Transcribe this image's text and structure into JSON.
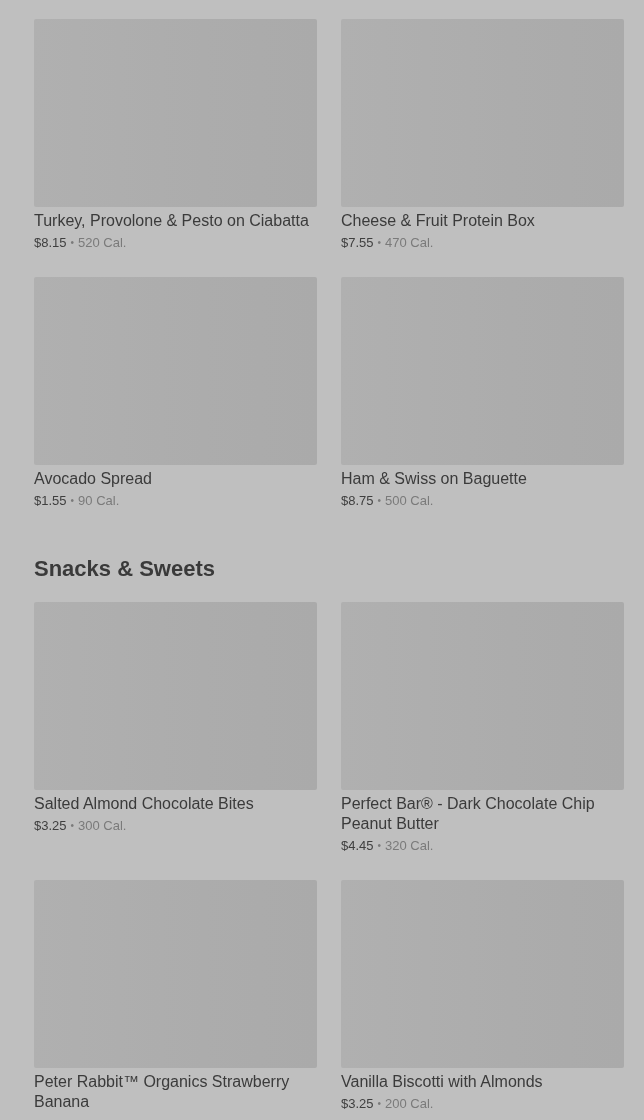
{
  "sections": [
    {
      "items": [
        {
          "name": "Turkey, Provolone & Pesto on Ciabatta",
          "price": "$8.15",
          "separator": "•",
          "calories": "520 Cal."
        },
        {
          "name": "Cheese & Fruit Protein Box",
          "price": "$7.55",
          "separator": "•",
          "calories": "470 Cal."
        },
        {
          "name": "Avocado Spread",
          "price": "$1.55",
          "separator": "•",
          "calories": "90 Cal."
        },
        {
          "name": "Ham & Swiss on Baguette",
          "price": "$8.75",
          "separator": "•",
          "calories": "500 Cal."
        }
      ]
    },
    {
      "title": "Snacks & Sweets",
      "items": [
        {
          "name": "Salted Almond Chocolate Bites",
          "price": "$3.25",
          "separator": "•",
          "calories": "300 Cal."
        },
        {
          "name": "Perfect Bar® - Dark Chocolate Chip Peanut Butter",
          "price": "$4.45",
          "separator": "•",
          "calories": "320 Cal."
        },
        {
          "name": "Peter Rabbit™ Organics Strawberry Banana"
        },
        {
          "name": "Vanilla Biscotti with Almonds",
          "price": "$3.25",
          "separator": "•",
          "calories": "200 Cal."
        }
      ]
    }
  ]
}
